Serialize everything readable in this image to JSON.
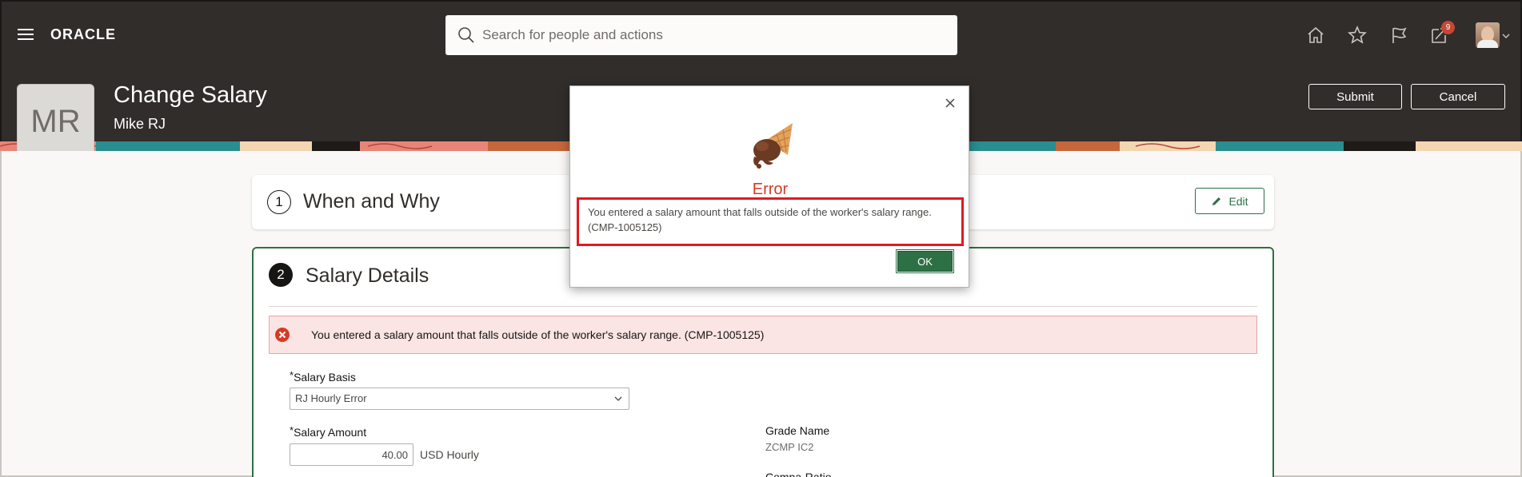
{
  "header": {
    "brand": "ORACLE",
    "search_placeholder": "Search for people and actions",
    "notification_count": "9",
    "icons": [
      "menu-icon",
      "search-icon",
      "home-icon",
      "star-icon",
      "flag-icon",
      "notifications-icon",
      "user-avatar",
      "chevron-down-icon"
    ]
  },
  "page": {
    "avatar_initials": "MR",
    "avatar_more": "•••",
    "title": "Change Salary",
    "subtitle": "Mike RJ",
    "submit_label": "Submit",
    "cancel_label": "Cancel"
  },
  "sections": [
    {
      "number": "1",
      "title": "When and Why",
      "edit_label": "Edit"
    },
    {
      "number": "2",
      "title": "Salary Details"
    }
  ],
  "salary_details": {
    "error_banner": "You entered a salary amount that falls outside of the worker's salary range. (CMP-1005125)",
    "salary_basis_label": "Salary Basis",
    "salary_basis_value": "RJ Hourly Error",
    "salary_amount_label": "Salary Amount",
    "salary_amount_value": "40.00",
    "salary_amount_unit": "USD Hourly",
    "grade_name_label": "Grade Name",
    "grade_name_value": "ZCMP IC2",
    "compa_ratio_label": "Compa-Ratio",
    "required_marker": "*"
  },
  "dialog": {
    "title": "Error",
    "message_line1": "You entered a salary amount that falls outside of the worker's salary range.",
    "message_line2": "(CMP-1005125)",
    "ok_label": "OK",
    "close_glyph": "×"
  },
  "colors": {
    "topbar": "#312d2a",
    "accent_green": "#2e7045",
    "error_red": "#d63b25",
    "highlight_red": "#e01a22",
    "error_banner_bg": "#fae4e4"
  }
}
